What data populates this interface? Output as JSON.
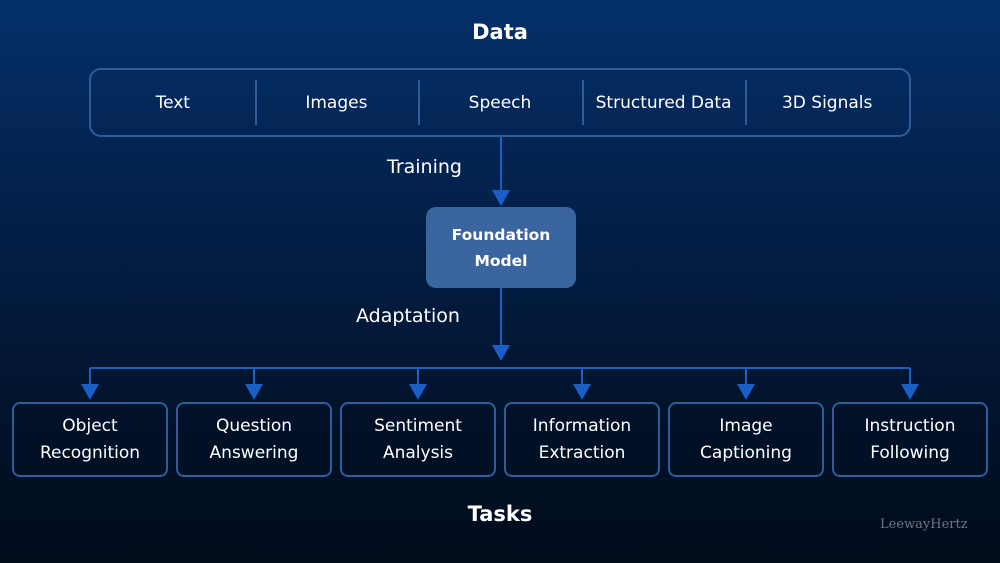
{
  "diagram": {
    "top_title": "Data",
    "data_sources": [
      "Text",
      "Images",
      "Speech",
      "Structured Data",
      "3D Signals"
    ],
    "training_label": "Training",
    "model_line1": "Foundation",
    "model_line2": "Model",
    "adaptation_label": "Adaptation",
    "tasks": [
      {
        "line1": "Object",
        "line2": "Recognition"
      },
      {
        "line1": "Question",
        "line2": "Answering"
      },
      {
        "line1": "Sentiment",
        "line2": "Analysis"
      },
      {
        "line1": "Information",
        "line2": "Extraction"
      },
      {
        "line1": "Image",
        "line2": "Captioning"
      },
      {
        "line1": "Instruction",
        "line2": "Following"
      }
    ],
    "bottom_title": "Tasks",
    "watermark": "LeewayHertz",
    "colors": {
      "arrow": "#1a5fc8",
      "box_border": "#2f5d9a",
      "model_fill": "#3a659e"
    }
  }
}
